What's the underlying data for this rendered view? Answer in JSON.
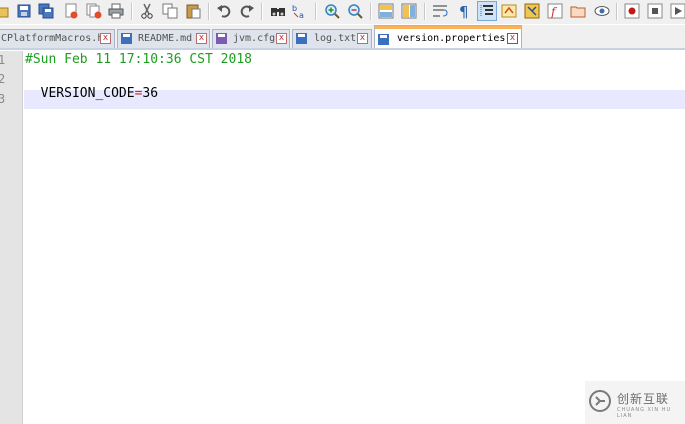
{
  "toolbar": {
    "icons": [
      "open-icon",
      "save-icon",
      "save-all-icon",
      "close-icon",
      "close-all-icon",
      "print-icon",
      "cut-icon",
      "copy-icon",
      "paste-icon",
      "undo-icon",
      "redo-icon",
      "find-icon",
      "replace-icon",
      "zoom-in-icon",
      "zoom-out-icon",
      "sync-vertical-icon",
      "sync-horizontal-icon",
      "word-wrap-icon",
      "show-all-chars-icon",
      "indent-guide-icon",
      "user-language-icon",
      "doc-map-icon",
      "function-list-icon",
      "folder-workspace-icon",
      "monitoring-icon",
      "record-macro-icon",
      "stop-record-icon",
      "play-macro-icon"
    ]
  },
  "tabs": [
    {
      "label": "CPlatformMacros.h",
      "close": "x"
    },
    {
      "label": "README.md",
      "close": "x"
    },
    {
      "label": "jvm.cfg",
      "close": "x"
    },
    {
      "label": "log.txt",
      "close": "x"
    },
    {
      "label": "version.properties",
      "close": "x"
    }
  ],
  "editor": {
    "line_numbers": [
      "1",
      "2",
      "3"
    ],
    "line1": "#Sun Feb 11 17:10:36 CST 2018",
    "line2_key": "VERSION_CODE",
    "line2_op": "=",
    "line2_val": "36"
  },
  "watermark": {
    "title": "创新互联",
    "subtitle": "CHUANG XIN HU LIAN"
  },
  "colors": {
    "comment": "#1e9e1e",
    "operator": "#e02020",
    "current_line": "#e8e8ff",
    "active_tab_accent": "#fab35b"
  }
}
